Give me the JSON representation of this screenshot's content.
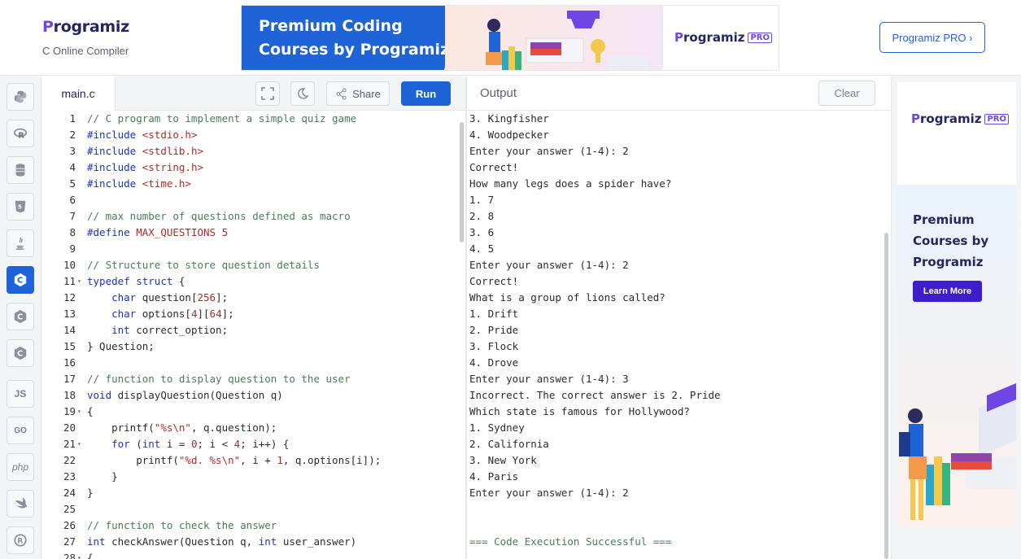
{
  "header": {
    "logo_text": "rogramiz",
    "logo_p": "P",
    "subtitle": "C Online Compiler",
    "banner": {
      "line1": "Premium Coding",
      "line2": "Courses by Programiz",
      "pro_logo": "rogramiz",
      "pro_logo_p": "P",
      "pro_tag": "PRO"
    },
    "pro_button": "Programiz PRO ›"
  },
  "sidebar": {
    "languages": [
      "python",
      "r",
      "sql",
      "html",
      "java",
      "c",
      "c++",
      "c#",
      "js",
      "go",
      "php",
      "swift",
      "rust"
    ],
    "active": "c",
    "js_label": "JS",
    "go_label": "GO",
    "php_label": "php"
  },
  "editor": {
    "tab": "main.c",
    "share_label": "Share",
    "run_label": "Run",
    "lines": [
      {
        "n": "1",
        "html": "<span class=\"cm\">// C program to implement a simple quiz game</span>"
      },
      {
        "n": "2",
        "html": "<span class=\"pp\">#include</span> <span class=\"st\">&lt;stdio.h&gt;</span>"
      },
      {
        "n": "3",
        "html": "<span class=\"pp\">#include</span> <span class=\"st\">&lt;stdlib.h&gt;</span>"
      },
      {
        "n": "4",
        "html": "<span class=\"pp\">#include</span> <span class=\"st\">&lt;string.h&gt;</span>"
      },
      {
        "n": "5",
        "html": "<span class=\"pp\">#include</span> <span class=\"st\">&lt;time.h&gt;</span>"
      },
      {
        "n": "6",
        "html": ""
      },
      {
        "n": "7",
        "html": "<span class=\"cm\">// max number of questions defined as macro</span>"
      },
      {
        "n": "8",
        "html": "<span class=\"pp\">#define</span> <span class=\"st\">MAX_QUESTIONS 5</span>"
      },
      {
        "n": "9",
        "html": ""
      },
      {
        "n": "10",
        "html": "<span class=\"cm\">// Structure to store question details</span>"
      },
      {
        "n": "11",
        "fold": true,
        "html": "<span class=\"kw\">typedef</span> <span class=\"kw\">struct</span> {"
      },
      {
        "n": "12",
        "html": "    <span class=\"kw\">char</span> question[<span class=\"num\">256</span>];"
      },
      {
        "n": "13",
        "html": "    <span class=\"kw\">char</span> options[<span class=\"num\">4</span>][<span class=\"num\">64</span>];"
      },
      {
        "n": "14",
        "html": "    <span class=\"kw\">int</span> correct_option;"
      },
      {
        "n": "15",
        "html": "} Question;"
      },
      {
        "n": "16",
        "html": ""
      },
      {
        "n": "17",
        "html": "<span class=\"cm\">// function to display question to the user</span>"
      },
      {
        "n": "18",
        "html": "<span class=\"kw\">void</span> displayQuestion(Question q)"
      },
      {
        "n": "19",
        "fold": true,
        "html": "{"
      },
      {
        "n": "20",
        "html": "    printf(<span class=\"st\">\"%s\\n\"</span>, q.question);"
      },
      {
        "n": "21",
        "fold": true,
        "html": "    <span class=\"kw\">for</span> (<span class=\"kw\">int</span> i = <span class=\"num\">0</span>; i &lt; <span class=\"num\">4</span>; i++) {"
      },
      {
        "n": "22",
        "html": "        printf(<span class=\"st\">\"%d. %s\\n\"</span>, i + <span class=\"num\">1</span>, q.options[i]);"
      },
      {
        "n": "23",
        "html": "    }"
      },
      {
        "n": "24",
        "html": "}"
      },
      {
        "n": "25",
        "html": ""
      },
      {
        "n": "26",
        "html": "<span class=\"cm\">// function to check the answer</span>"
      },
      {
        "n": "27",
        "html": "<span class=\"kw\">int</span> checkAnswer(Question q, <span class=\"kw\">int</span> user_answer)"
      },
      {
        "n": "28",
        "fold": true,
        "html": "{"
      }
    ]
  },
  "output": {
    "title": "Output",
    "clear_label": "Clear",
    "lines": [
      "3. Kingfisher",
      "4. Woodpecker",
      "Enter your answer (1-4): 2",
      "Correct!",
      "How many legs does a spider have?",
      "1. 7",
      "2. 8",
      "3. 6",
      "4. 5",
      "Enter your answer (1-4): 2",
      "Correct!",
      "What is a group of lions called?",
      "1. Drift",
      "2. Pride",
      "3. Flock",
      "4. Drove",
      "Enter your answer (1-4): 3",
      "Incorrect. The correct answer is 2. Pride",
      "Which state is famous for Hollywood?",
      "1. Sydney",
      "2. California",
      "3. New York",
      "4. Paris",
      "Enter your answer (1-4): 2",
      "",
      "",
      "=== Code Execution Successful ==="
    ]
  },
  "ad": {
    "logo_p": "P",
    "logo_text": "rogramiz",
    "pro_tag": "PRO",
    "heading1": "Premium",
    "heading2": "Courses by",
    "heading3": "Programiz",
    "learn_more": "Learn More"
  },
  "colors": {
    "brand_blue": "#1e63d8",
    "brand_purple": "#6f45e5",
    "navy": "#25265e"
  }
}
